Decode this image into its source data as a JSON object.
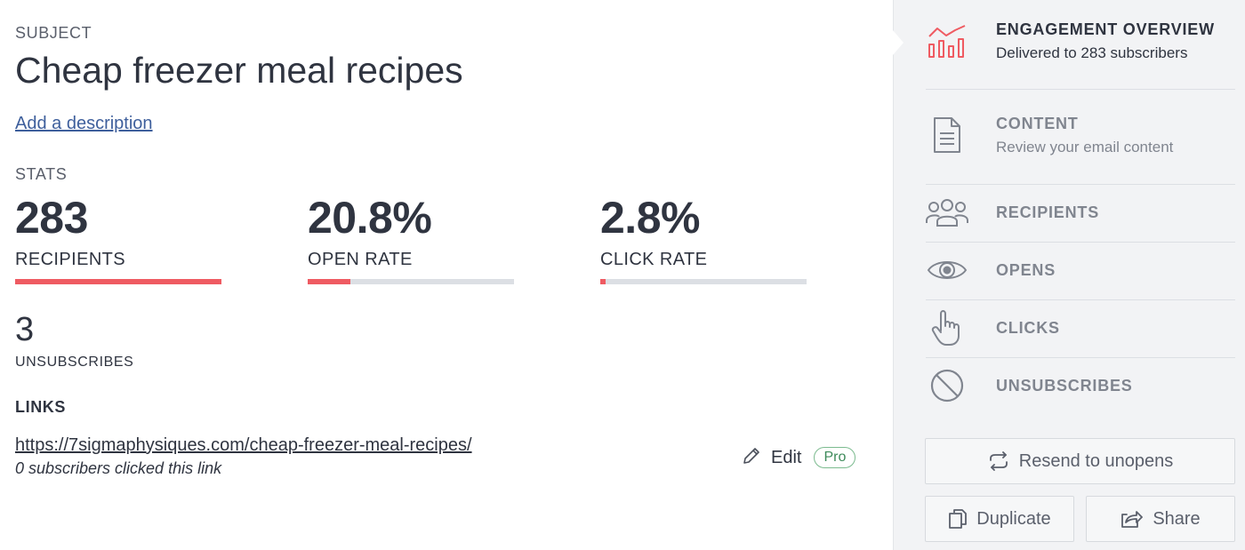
{
  "main": {
    "subject_label": "SUBJECT",
    "title": "Cheap freezer meal recipes",
    "add_description": "Add a description",
    "stats_label": "STATS",
    "stats": [
      {
        "value": "283",
        "label": "RECIPIENTS",
        "progress": 1.0
      },
      {
        "value": "20.8%",
        "label": "OPEN RATE",
        "progress": 0.208
      },
      {
        "value": "2.8%",
        "label": "CLICK RATE",
        "progress": 0.028
      }
    ],
    "unsubscribes_value": "3",
    "unsubscribes_label": "UNSUBSCRIBES",
    "links_heading": "LINKS",
    "link": {
      "url": "https://7sigmaphysiques.com/cheap-freezer-meal-recipes/",
      "note": "0 subscribers clicked this link",
      "edit_label": "Edit",
      "badge": "Pro"
    }
  },
  "sidebar": {
    "items": [
      {
        "title": "ENGAGEMENT OVERVIEW",
        "subtitle": "Delivered to 283 subscribers",
        "icon": "bar-chart-icon",
        "active": true
      },
      {
        "title": "CONTENT",
        "subtitle": "Review your email content",
        "icon": "document-icon",
        "active": false
      },
      {
        "title": "RECIPIENTS",
        "icon": "people-icon",
        "active": false
      },
      {
        "title": "OPENS",
        "icon": "eye-icon",
        "active": false
      },
      {
        "title": "CLICKS",
        "icon": "pointer-hand-icon",
        "active": false
      },
      {
        "title": "UNSUBSCRIBES",
        "icon": "block-icon",
        "active": false
      }
    ],
    "resend_label": "Resend to unopens",
    "duplicate_label": "Duplicate",
    "share_label": "Share"
  },
  "colors": {
    "accent": "#ef5b62",
    "link": "#3e5f9c",
    "pro_badge": "#3d8a5a"
  }
}
